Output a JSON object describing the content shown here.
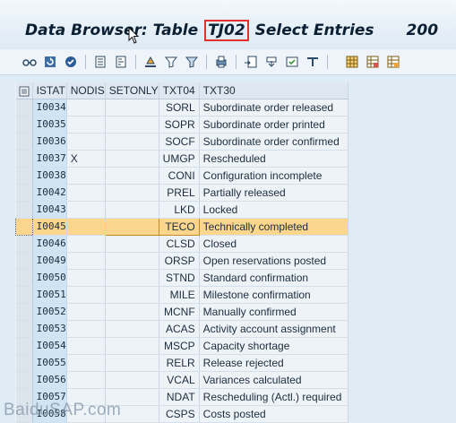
{
  "window": {
    "title_prefix": "Data Browser: Table ",
    "table_name": "TJ02",
    "title_suffix": " Select Entries",
    "entry_count": "200"
  },
  "toolbar": {
    "icons": [
      "glasses-icon",
      "refresh-icon",
      "check-table-icon",
      "details-icon",
      "sort-ascending-icon",
      "sort-descending-icon",
      "filter-icon",
      "find-icon",
      "print-icon",
      "export-icon",
      "download-icon",
      "choose-icon",
      "layout-icon",
      "layout-change-icon",
      "layout-save-icon"
    ]
  },
  "table": {
    "columns": [
      "ISTAT",
      "NODIS",
      "SETONLY",
      "TXT04",
      "TXT30"
    ],
    "rows": [
      {
        "istat": "I0034",
        "nodis": "",
        "setonly": "",
        "txt04": "SORL",
        "txt30": "Subordinate order released"
      },
      {
        "istat": "I0035",
        "nodis": "",
        "setonly": "",
        "txt04": "SOPR",
        "txt30": "Subordinate order printed"
      },
      {
        "istat": "I0036",
        "nodis": "",
        "setonly": "",
        "txt04": "SOCF",
        "txt30": "Subordinate order confirmed"
      },
      {
        "istat": "I0037",
        "nodis": "X",
        "setonly": "",
        "txt04": "UMGP",
        "txt30": "Rescheduled"
      },
      {
        "istat": "I0038",
        "nodis": "",
        "setonly": "",
        "txt04": "CONI",
        "txt30": "Configuration incomplete"
      },
      {
        "istat": "I0042",
        "nodis": "",
        "setonly": "",
        "txt04": "PREL",
        "txt30": "Partially released"
      },
      {
        "istat": "I0043",
        "nodis": "",
        "setonly": "",
        "txt04": "LKD",
        "txt30": "Locked"
      },
      {
        "istat": "I0045",
        "nodis": "",
        "setonly": "",
        "txt04": "TECO",
        "txt30": "Technically completed",
        "highlighted": true
      },
      {
        "istat": "I0046",
        "nodis": "",
        "setonly": "",
        "txt04": "CLSD",
        "txt30": "Closed"
      },
      {
        "istat": "I0049",
        "nodis": "",
        "setonly": "",
        "txt04": "ORSP",
        "txt30": "Open reservations posted"
      },
      {
        "istat": "I0050",
        "nodis": "",
        "setonly": "",
        "txt04": "STND",
        "txt30": "Standard confirmation"
      },
      {
        "istat": "I0051",
        "nodis": "",
        "setonly": "",
        "txt04": "MILE",
        "txt30": "Milestone confirmation"
      },
      {
        "istat": "I0052",
        "nodis": "",
        "setonly": "",
        "txt04": "MCNF",
        "txt30": "Manually confirmed"
      },
      {
        "istat": "I0053",
        "nodis": "",
        "setonly": "",
        "txt04": "ACAS",
        "txt30": "Activity account assignment"
      },
      {
        "istat": "I0054",
        "nodis": "",
        "setonly": "",
        "txt04": "MSCP",
        "txt30": "Capacity shortage"
      },
      {
        "istat": "I0055",
        "nodis": "",
        "setonly": "",
        "txt04": "RELR",
        "txt30": "Release rejected"
      },
      {
        "istat": "I0056",
        "nodis": "",
        "setonly": "",
        "txt04": "VCAL",
        "txt30": "Variances calculated"
      },
      {
        "istat": "I0057",
        "nodis": "",
        "setonly": "",
        "txt04": "NDAT",
        "txt30": "Rescheduling (Actl.) required"
      },
      {
        "istat": "I0058",
        "nodis": "",
        "setonly": "",
        "txt04": "CSPS",
        "txt30": "Costs posted"
      }
    ]
  },
  "watermark": "BaiduSAP.com",
  "colors": {
    "highlight_row": "#fcd68c",
    "title_box": "#e0312e",
    "key_column": "#cfe5f4",
    "background": "#dfebf5"
  }
}
